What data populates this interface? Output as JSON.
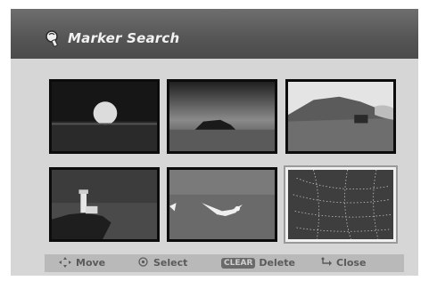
{
  "header": {
    "title": "Marker Search",
    "icon": "magnifier-icon"
  },
  "thumbnails": [
    {
      "name": "sunset-thumbnail",
      "selected": false
    },
    {
      "name": "island-thumbnail",
      "selected": false
    },
    {
      "name": "coast-house-thumbnail",
      "selected": false
    },
    {
      "name": "lighthouse-thumbnail",
      "selected": false
    },
    {
      "name": "seagull-thumbnail",
      "selected": false
    },
    {
      "name": "spiderweb-thumbnail",
      "selected": true
    }
  ],
  "help_bar": {
    "move": {
      "icon": "dpad-icon",
      "label": "Move"
    },
    "select": {
      "icon": "circle-icon",
      "label": "Select"
    },
    "delete": {
      "badge": "CLEAR",
      "label": "Delete"
    },
    "close": {
      "icon": "return-icon",
      "label": "Close"
    }
  },
  "colors": {
    "titlebar": "#555555",
    "panel": "#d6d6d6",
    "helpbar": "#b9b9b9",
    "selection_border": "#f0f0f0"
  }
}
